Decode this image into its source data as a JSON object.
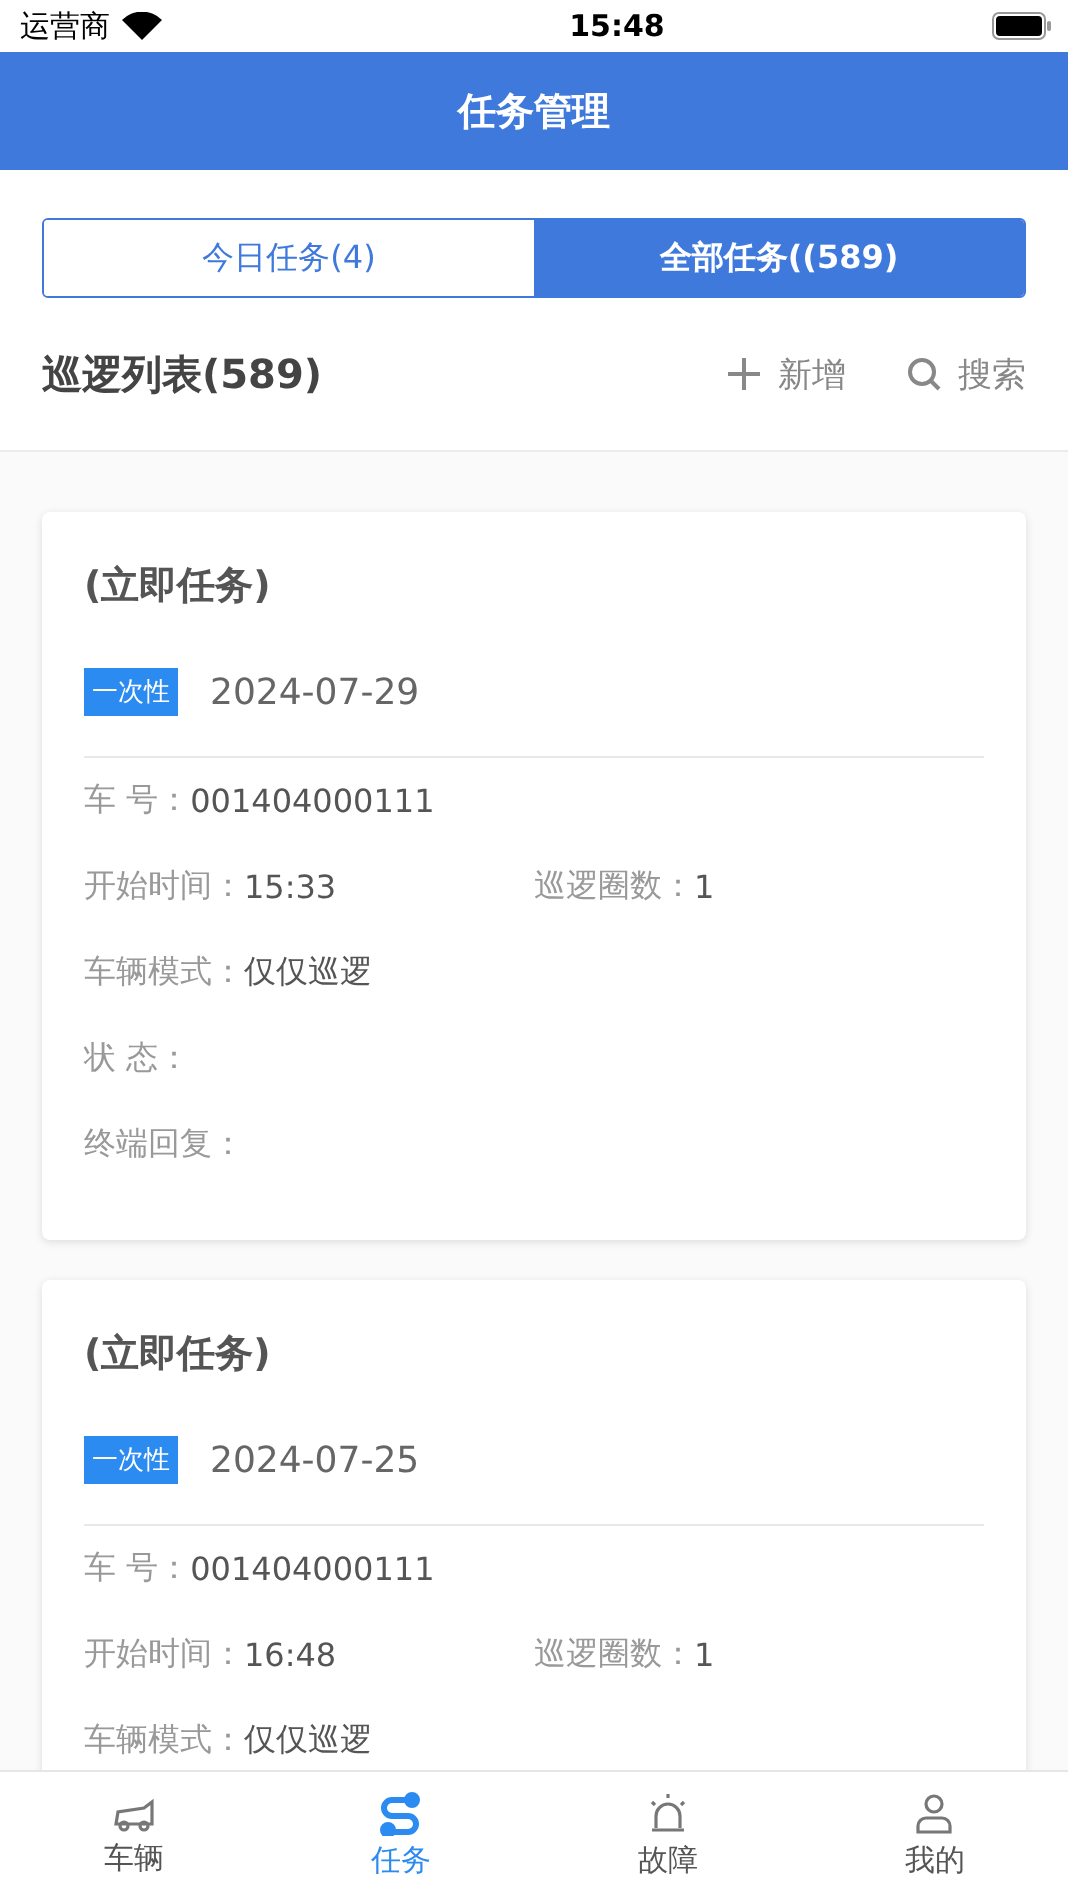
{
  "status_bar": {
    "carrier": "运营商",
    "time": "15:48"
  },
  "header": {
    "title": "任务管理"
  },
  "tabs": [
    {
      "label": "今日任务(4)",
      "selected": false
    },
    {
      "label": "全部任务((589)",
      "selected": true
    }
  ],
  "list_header": {
    "title": "巡逻列表(589)",
    "actions": [
      {
        "kind": "add",
        "label": "新增"
      },
      {
        "kind": "search",
        "label": "搜索"
      }
    ]
  },
  "tasks": [
    {
      "title": "(立即任务)",
      "tag": "一次性",
      "date": "2024-07-29",
      "rows": [
        [
          {
            "label": "车 号：",
            "value": "001404000111"
          }
        ],
        [
          {
            "label": "开始时间：",
            "value": "15:33"
          },
          {
            "label": "巡逻圈数：",
            "value": "1"
          }
        ],
        [
          {
            "label": "车辆模式：",
            "value": "仅仅巡逻"
          }
        ],
        [
          {
            "label": "状 态："
          }
        ],
        [
          {
            "label": "终端回复："
          }
        ]
      ]
    },
    {
      "title": "(立即任务)",
      "tag": "一次性",
      "date": "2024-07-25",
      "rows": [
        [
          {
            "label": "车 号：",
            "value": "001404000111"
          }
        ],
        [
          {
            "label": "开始时间：",
            "value": "16:48"
          },
          {
            "label": "巡逻圈数：",
            "value": "1"
          }
        ],
        [
          {
            "label": "车辆模式：",
            "value": "仅仅巡逻"
          }
        ]
      ]
    }
  ],
  "tab_bar": [
    {
      "kind": "vehicle",
      "label": "车辆",
      "selected": false
    },
    {
      "kind": "task",
      "label": "任务",
      "selected": true
    },
    {
      "kind": "fault",
      "label": "故障",
      "selected": false
    },
    {
      "kind": "me",
      "label": "我的",
      "selected": false
    }
  ]
}
